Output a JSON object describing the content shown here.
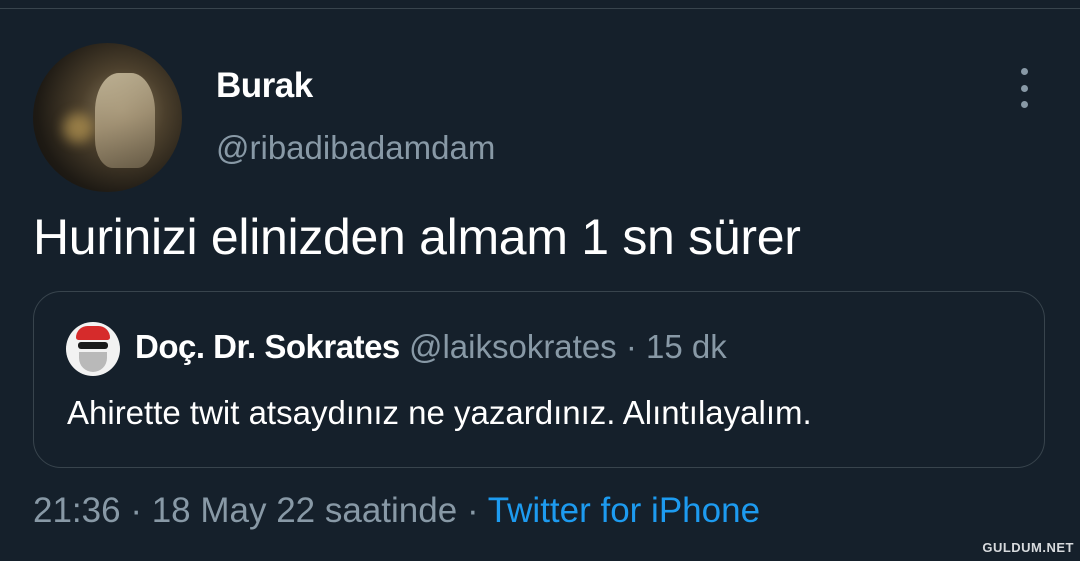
{
  "tweet": {
    "author_name": "Burak",
    "author_handle": "@ribadibadamdam",
    "text": "Hurinizi elinizden almam 1 sn sürer",
    "time": "21:36",
    "separator": "·",
    "date": "18 May 22 saatinde",
    "source": "Twitter for iPhone"
  },
  "quoted_tweet": {
    "author_name": "Doç. Dr. Sokrates",
    "author_handle": "@laiksokrates",
    "separator": "·",
    "time": "15 dk",
    "text": "Ahirette twit atsaydınız ne yazardınız. Alıntılayalım."
  },
  "icons": {
    "more": "more-vertical-icon"
  },
  "watermark": "GULDUM.NET",
  "colors": {
    "background": "#15202b",
    "secondary_text": "#8899a6",
    "link": "#1d9bf0",
    "border": "#38444d"
  }
}
